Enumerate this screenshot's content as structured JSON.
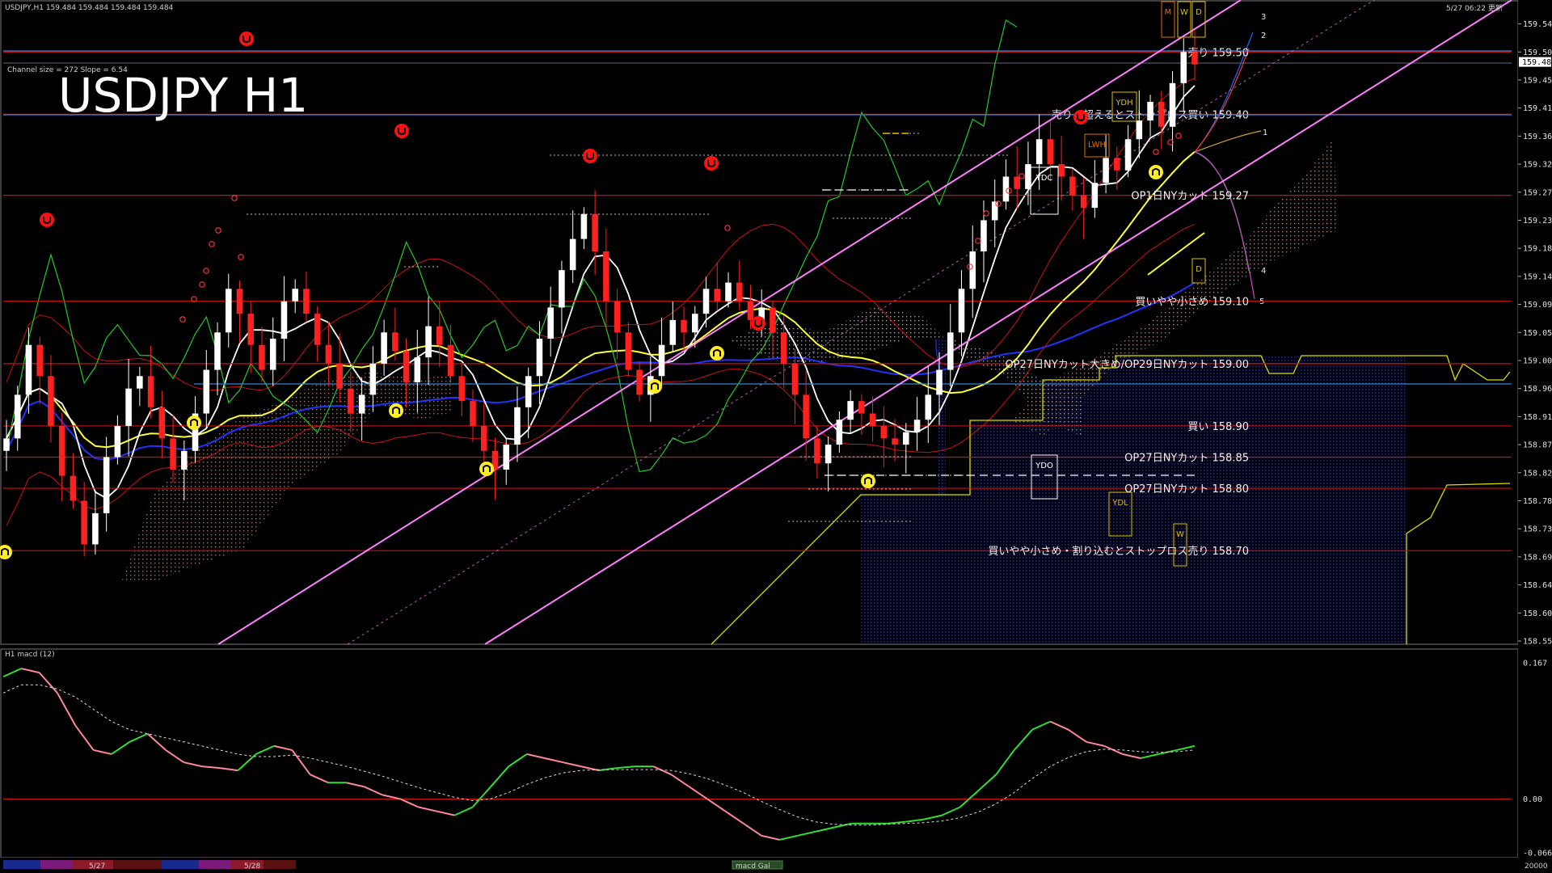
{
  "header": {
    "symbol_info": "USDJPY,H1  159.484 159.484 159.484 159.484",
    "datetime": "5/27 06:22 更新",
    "channel_info": "Channel size = 272 Slope = 6.54",
    "big_title": "USDJPY H1"
  },
  "colors": {
    "background": "#000000",
    "bull_candle": "#ffffff",
    "bear_candle": "#ff2020",
    "channel": "#ff80ff",
    "level_line": "#cc1111",
    "blue_level": "#3a7fd0",
    "ma_white": "#ffffff",
    "ma_yellow": "#ffff33",
    "ma_blue": "#2233ff",
    "chikou": "#22cc22",
    "bollinger": "#cc1111",
    "cloud": "#d09070",
    "macd_up": "#33dd33",
    "macd_down": "#ff8899"
  },
  "price_axis": {
    "ticks": [
      "159.545",
      "159.500",
      "159.455",
      "159.410",
      "159.365",
      "159.320",
      "159.275",
      "159.230",
      "159.185",
      "159.140",
      "159.095",
      "159.050",
      "159.005",
      "158.960",
      "158.915",
      "158.870",
      "158.825",
      "158.780",
      "158.735",
      "158.690",
      "158.645",
      "158.600",
      "158.555"
    ],
    "current_price": "159.484"
  },
  "levels": [
    {
      "label": "売り 159.50",
      "price": 159.5
    },
    {
      "label": "売り・超えるとストップロス買い 159.40",
      "price": 159.4
    },
    {
      "label": "OP1日NYカット 159.27",
      "price": 159.27
    },
    {
      "label": "買いやや小さめ 159.10",
      "price": 159.1
    },
    {
      "label": "OP27日NYカット大きめ/OP29日NYカット 159.00",
      "price": 159.0
    },
    {
      "label": "買い 158.90",
      "price": 158.9
    },
    {
      "label": "OP27日NYカット 158.85",
      "price": 158.85
    },
    {
      "label": "OP27日NYカット 158.80",
      "price": 158.8
    },
    {
      "label": "買いやや小さめ・割り込むとストップロス売り 158.70",
      "price": 158.7
    }
  ],
  "box_labels": [
    {
      "text": "YDH",
      "color": "#e0c000"
    },
    {
      "text": "LWH",
      "color": "#e07000"
    },
    {
      "text": "YDC",
      "color": "#ffffff"
    },
    {
      "text": "YDO",
      "color": "#ffffff"
    },
    {
      "text": "YDL",
      "color": "#e0c000"
    },
    {
      "text": "M",
      "color": "#e07000"
    },
    {
      "text": "W",
      "color": "#e0c000"
    },
    {
      "text": "D",
      "color": "#e0c000"
    },
    {
      "text": "D",
      "color": "#e0c000"
    },
    {
      "text": "W",
      "color": "#e0c000"
    }
  ],
  "projection_labels": [
    "3",
    "2",
    "1",
    "4",
    "5"
  ],
  "macd": {
    "title": "H1  macd (12)",
    "ticks": [
      "0.167",
      "0.00",
      "-0.066"
    ]
  },
  "bottom_bar": {
    "dates": [
      "5/27",
      "5/28"
    ],
    "scroll_label": "macd Gal",
    "right_value": "20000"
  },
  "chart_data": [
    {
      "type": "candlestick",
      "title": "USDJPY H1",
      "ylim": [
        158.555,
        159.56
      ],
      "series_note": "approx hourly closes read from chart",
      "close": [
        158.88,
        158.95,
        159.03,
        158.98,
        158.9,
        158.82,
        158.78,
        158.71,
        158.76,
        158.85,
        158.9,
        158.96,
        158.98,
        158.93,
        158.88,
        158.83,
        158.86,
        158.92,
        158.99,
        159.05,
        159.12,
        159.08,
        159.03,
        158.99,
        159.04,
        159.1,
        159.12,
        159.08,
        159.03,
        159.0,
        158.96,
        158.92,
        158.95,
        159.0,
        159.05,
        159.02,
        158.97,
        159.01,
        159.06,
        159.03,
        158.98,
        158.94,
        158.9,
        158.86,
        158.83,
        158.87,
        158.93,
        158.98,
        159.04,
        159.09,
        159.15,
        159.2,
        159.24,
        159.18,
        159.1,
        159.05,
        158.99,
        158.95,
        158.98,
        159.03,
        159.07,
        159.05,
        159.08,
        159.12,
        159.1,
        159.13,
        159.1,
        159.07,
        159.09,
        159.05,
        159.0,
        158.95,
        158.88,
        158.84,
        158.87,
        158.91,
        158.94,
        158.92,
        158.9,
        158.88,
        158.87,
        158.89,
        158.91,
        158.95,
        158.99,
        159.05,
        159.12,
        159.18,
        159.23,
        159.26,
        159.3,
        159.28,
        159.32,
        159.36,
        159.32,
        159.3,
        159.27,
        159.25,
        159.29,
        159.33,
        159.31,
        159.36,
        159.39,
        159.42,
        159.38,
        159.45,
        159.5,
        159.48
      ]
    },
    {
      "type": "line",
      "title": "macd (12)",
      "ylim": [
        -0.066,
        0.167
      ],
      "macd": [
        0.15,
        0.16,
        0.155,
        0.13,
        0.09,
        0.06,
        0.055,
        0.07,
        0.08,
        0.06,
        0.045,
        0.04,
        0.038,
        0.035,
        0.055,
        0.065,
        0.06,
        0.03,
        0.02,
        0.02,
        0.015,
        0.005,
        0.0,
        -0.01,
        -0.015,
        -0.02,
        -0.01,
        0.015,
        0.04,
        0.055,
        0.05,
        0.045,
        0.04,
        0.035,
        0.038,
        0.04,
        0.04,
        0.03,
        0.015,
        0.0,
        -0.015,
        -0.03,
        -0.045,
        -0.05,
        -0.045,
        -0.04,
        -0.035,
        -0.03,
        -0.03,
        -0.03,
        -0.028,
        -0.025,
        -0.02,
        -0.01,
        0.01,
        0.03,
        0.06,
        0.085,
        0.095,
        0.085,
        0.07,
        0.065,
        0.055,
        0.05,
        0.055,
        0.06,
        0.065
      ],
      "signal": [
        0.13,
        0.14,
        0.14,
        0.135,
        0.125,
        0.11,
        0.095,
        0.085,
        0.08,
        0.075,
        0.07,
        0.065,
        0.06,
        0.055,
        0.052,
        0.052,
        0.054,
        0.05,
        0.045,
        0.04,
        0.034,
        0.028,
        0.021,
        0.014,
        0.008,
        0.002,
        -0.002,
        0.0,
        0.008,
        0.018,
        0.026,
        0.032,
        0.035,
        0.036,
        0.036,
        0.036,
        0.036,
        0.035,
        0.031,
        0.025,
        0.017,
        0.008,
        -0.003,
        -0.013,
        -0.022,
        -0.028,
        -0.031,
        -0.032,
        -0.032,
        -0.031,
        -0.03,
        -0.029,
        -0.027,
        -0.023,
        -0.016,
        -0.006,
        0.008,
        0.025,
        0.04,
        0.051,
        0.058,
        0.061,
        0.06,
        0.058,
        0.057,
        0.058,
        0.06
      ]
    }
  ]
}
